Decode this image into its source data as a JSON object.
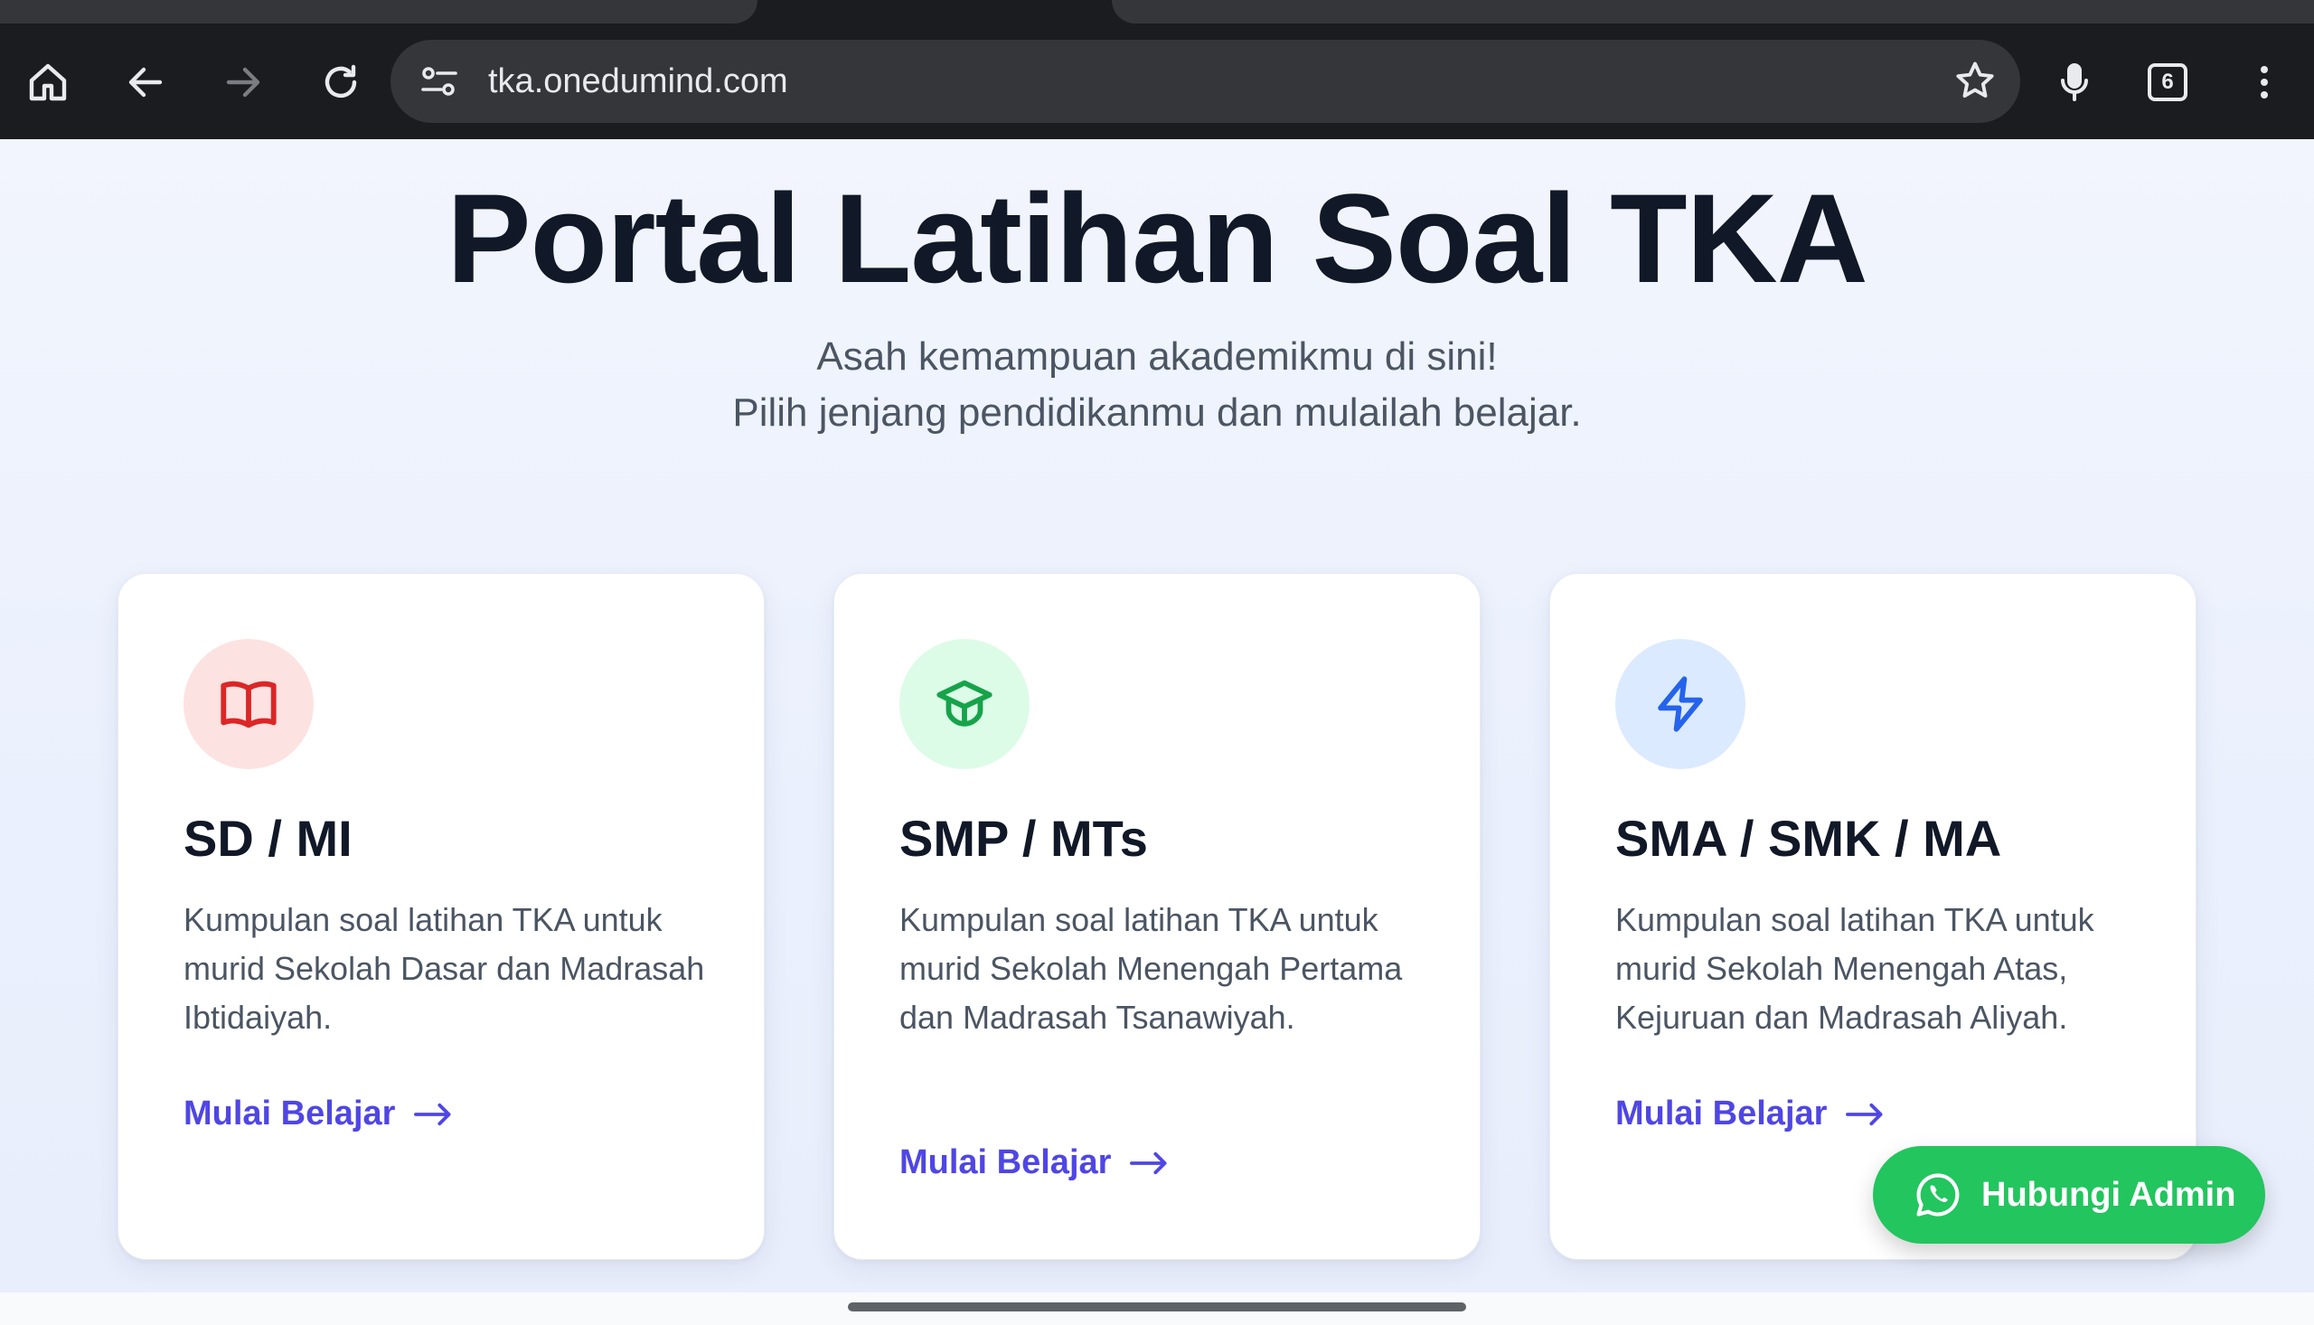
{
  "browser": {
    "url": "tka.onedumind.com",
    "tab_count": "6",
    "icons": [
      "home-icon",
      "back-icon",
      "forward-icon",
      "reload-icon",
      "site-info-icon",
      "bookmark-star-icon",
      "microphone-icon",
      "tab-switcher-icon",
      "more-menu-icon"
    ]
  },
  "hero": {
    "title": "Portal Latihan Soal TKA",
    "subtitle_line1": "Asah kemampuan akademikmu di sini!",
    "subtitle_line2": "Pilih jenjang pendidikanmu dan mulailah belajar."
  },
  "cards": [
    {
      "title": "SD / MI",
      "description": "Kumpulan soal latihan TKA untuk murid Sekolah Dasar dan Madrasah Ibtidaiyah.",
      "cta": "Mulai Belajar",
      "icon": "book-open-icon",
      "accent": "#dc2626",
      "icon_bg": "#fde2e2"
    },
    {
      "title": "SMP / MTs",
      "description": "Kumpulan soal latihan TKA untuk murid Sekolah Menengah Pertama dan Madrasah Tsanawiyah.",
      "cta": "Mulai Belajar",
      "icon": "graduation-cap-icon",
      "accent": "#16a34a",
      "icon_bg": "#dcfce7"
    },
    {
      "title": "SMA / SMK / MA",
      "description": "Kumpulan soal latihan TKA untuk murid Sekolah Menengah Atas, Kejuruan dan Madrasah Aliyah.",
      "cta": "Mulai Belajar",
      "icon": "lightning-bolt-icon",
      "accent": "#2563eb",
      "icon_bg": "#dbeafe"
    }
  ],
  "whatsapp": {
    "label": "Hubungi Admin",
    "icon": "whatsapp-icon",
    "color": "#22c55e"
  },
  "colors": {
    "cta": "#4f46e5",
    "title": "#111827",
    "body_text": "#4b5563"
  }
}
